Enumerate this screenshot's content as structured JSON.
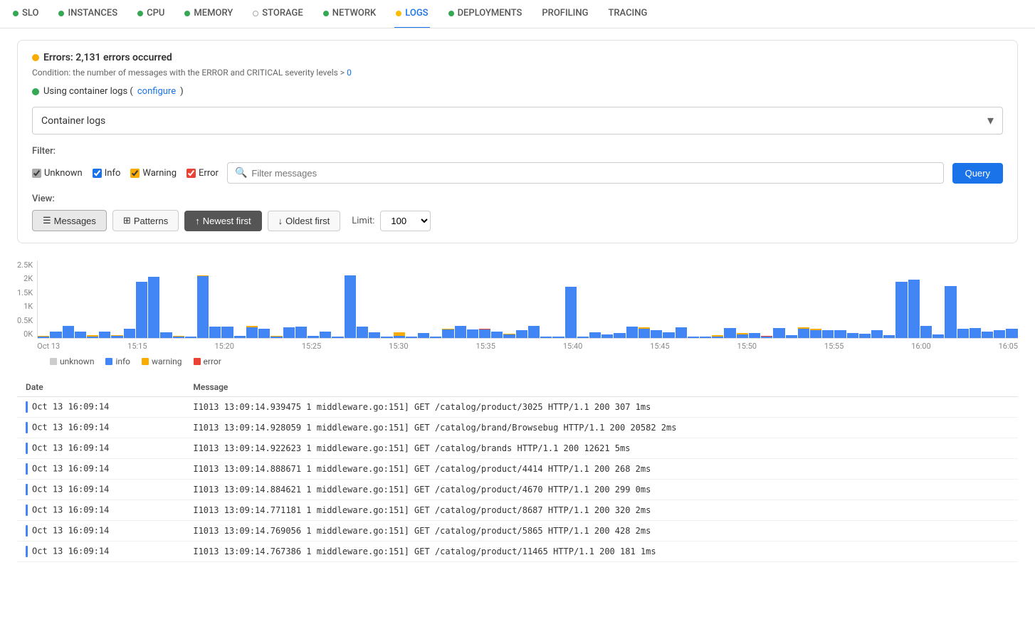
{
  "nav": {
    "items": [
      {
        "label": "SLO",
        "dot": "green",
        "active": false
      },
      {
        "label": "INSTANCES",
        "dot": "green",
        "active": false
      },
      {
        "label": "CPU",
        "dot": "green",
        "active": false
      },
      {
        "label": "MEMORY",
        "dot": "green",
        "active": false
      },
      {
        "label": "STORAGE",
        "dot": "empty",
        "active": false
      },
      {
        "label": "NETWORK",
        "dot": "green",
        "active": false
      },
      {
        "label": "LOGS",
        "dot": "yellow",
        "active": true
      },
      {
        "label": "DEPLOYMENTS",
        "dot": "green",
        "active": false
      },
      {
        "label": "PROFILING",
        "dot": "none",
        "active": false
      },
      {
        "label": "TRACING",
        "dot": "none",
        "active": false
      }
    ]
  },
  "alert": {
    "title": "Errors: 2,131 errors occurred",
    "condition": "Condition: the number of messages with the ERROR and CRITICAL severity levels > ",
    "condition_link": "0",
    "using_logs_text": "Using container logs (",
    "configure_label": "configure",
    "using_logs_close": ")"
  },
  "dropdown": {
    "value": "Container logs",
    "placeholder": "Container logs"
  },
  "filter": {
    "label": "Filter:",
    "checkboxes": [
      {
        "id": "unknown",
        "label": "Unknown",
        "checked": true
      },
      {
        "id": "info",
        "label": "Info",
        "checked": true
      },
      {
        "id": "warning",
        "label": "Warning",
        "checked": true
      },
      {
        "id": "error",
        "label": "Error",
        "checked": true
      }
    ],
    "search_placeholder": "Filter messages",
    "query_button": "Query"
  },
  "view": {
    "label": "View:",
    "messages_label": "Messages",
    "patterns_label": "Patterns",
    "newest_first_label": "Newest first",
    "oldest_first_label": "Oldest first",
    "limit_label": "Limit:",
    "limit_value": "100"
  },
  "chart": {
    "y_labels": [
      "2.5K",
      "2K",
      "1.5K",
      "1K",
      "0.5K",
      "0K"
    ],
    "x_labels": [
      "Oct 13",
      "15:15",
      "15:20",
      "15:25",
      "15:30",
      "15:35",
      "15:40",
      "15:45",
      "15:50",
      "15:55",
      "16:00",
      "16:05"
    ],
    "legend": [
      {
        "key": "unknown",
        "label": "unknown"
      },
      {
        "key": "info",
        "label": "info"
      },
      {
        "key": "warning",
        "label": "warning"
      },
      {
        "key": "error",
        "label": "error"
      }
    ]
  },
  "table": {
    "columns": [
      "Date",
      "Message"
    ],
    "rows": [
      {
        "date": "Oct 13 16:09:14",
        "message": "I1013 13:09:14.939475 1 middleware.go:151] GET /catalog/product/3025 HTTP/1.1 200 307 1ms"
      },
      {
        "date": "Oct 13 16:09:14",
        "message": "I1013 13:09:14.928059 1 middleware.go:151] GET /catalog/brand/Browsebug HTTP/1.1 200 20582 2ms"
      },
      {
        "date": "Oct 13 16:09:14",
        "message": "I1013 13:09:14.922623 1 middleware.go:151] GET /catalog/brands HTTP/1.1 200 12621 5ms"
      },
      {
        "date": "Oct 13 16:09:14",
        "message": "I1013 13:09:14.888671 1 middleware.go:151] GET /catalog/product/4414 HTTP/1.1 200 268 2ms"
      },
      {
        "date": "Oct 13 16:09:14",
        "message": "I1013 13:09:14.884621 1 middleware.go:151] GET /catalog/product/4670 HTTP/1.1 200 299 0ms"
      },
      {
        "date": "Oct 13 16:09:14",
        "message": "I1013 13:09:14.771181 1 middleware.go:151] GET /catalog/product/8687 HTTP/1.1 200 320 2ms"
      },
      {
        "date": "Oct 13 16:09:14",
        "message": "I1013 13:09:14.769056 1 middleware.go:151] GET /catalog/product/5865 HTTP/1.1 200 428 2ms"
      },
      {
        "date": "Oct 13 16:09:14",
        "message": "I1013 13:09:14.767386 1 middleware.go:151] GET /catalog/product/11465 HTTP/1.1 200 181 1ms"
      }
    ]
  }
}
